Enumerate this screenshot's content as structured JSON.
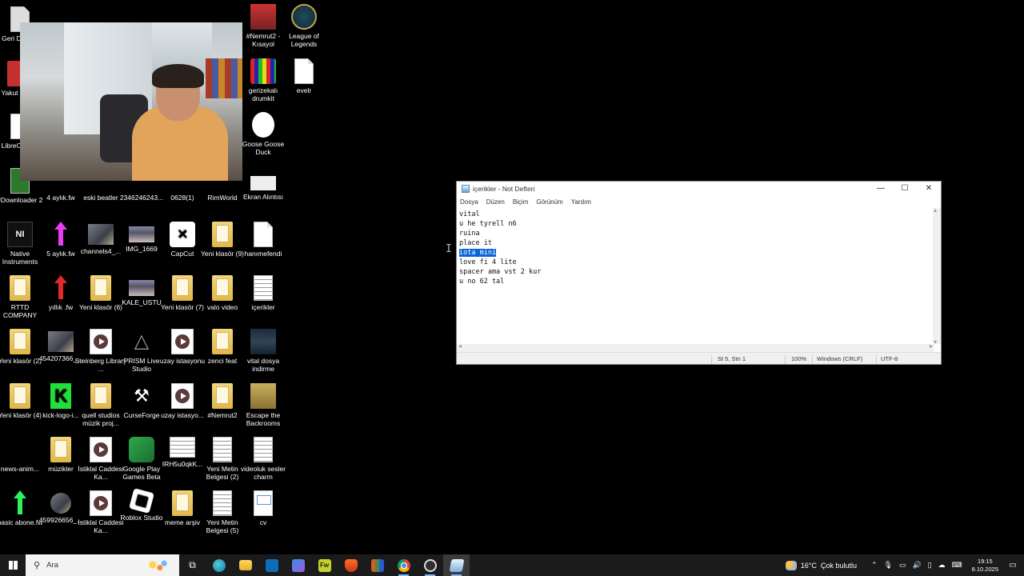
{
  "desktop": {
    "icons": [
      {
        "label": "Geri Dönü...",
        "icon": "recycle-bin-icon"
      },
      {
        "label": "Yakut tung...",
        "icon": "pdf-icon"
      },
      {
        "label": "LibreOf... 25",
        "icon": "doc-icon"
      },
      {
        "label": "JDownloader 2",
        "icon": "jdownloader-icon"
      },
      {
        "label": "Native Instruments",
        "icon": "native-instruments-icon"
      },
      {
        "label": "RTTD COMPANY",
        "icon": "folder-icon"
      },
      {
        "label": "Yeni klasör (2)",
        "icon": "folder-icon"
      },
      {
        "label": "Yeni klasör (4)",
        "icon": "folder-icon"
      },
      {
        "label": "news-anim...",
        "icon": "news-icon"
      },
      {
        "label": "basic abone.fw",
        "icon": "arrow-green-icon"
      },
      {
        "label": "4 aylık.fw",
        "icon": "arrow-cyan-icon"
      },
      {
        "label": "5 aylık.fw",
        "icon": "arrow-purple-icon"
      },
      {
        "label": "yıllık .fw",
        "icon": "arrow-red-icon"
      },
      {
        "label": "454207366_...",
        "icon": "photo-icon"
      },
      {
        "label": "kick-logo-i...",
        "icon": "kick-logo-icon"
      },
      {
        "label": "müzikler",
        "icon": "folder-icon"
      },
      {
        "label": "459926656_...",
        "icon": "photo-icon"
      },
      {
        "label": "eski beatler",
        "icon": "folder-icon"
      },
      {
        "label": "channels4_...",
        "icon": "photo-icon"
      },
      {
        "label": "Yeni klasör (6)",
        "icon": "folder-icon"
      },
      {
        "label": "Steinberg Library ...",
        "icon": "video-icon"
      },
      {
        "label": "quell studios müzik proj...",
        "icon": "folder-icon"
      },
      {
        "label": "İstiklal Caddesi Ka...",
        "icon": "video-icon"
      },
      {
        "label": "İstiklal Caddesi Ka...",
        "icon": "video-icon"
      },
      {
        "label": "2346246243...",
        "icon": "folder-icon"
      },
      {
        "label": "IMG_1669",
        "icon": "photo-icon"
      },
      {
        "label": "KALE_USTU",
        "icon": "photo-icon"
      },
      {
        "label": "PRISM Live Studio",
        "icon": "prism-icon"
      },
      {
        "label": "CurseForge",
        "icon": "curseforge-icon"
      },
      {
        "label": "Google Play Games Beta",
        "icon": "google-play-games-icon"
      },
      {
        "label": "Roblox Studio",
        "icon": "roblox-icon"
      },
      {
        "label": "0628(1)",
        "icon": "folder-icon"
      },
      {
        "label": "CapCut",
        "icon": "capcut-icon"
      },
      {
        "label": "Yeni klasör (7)",
        "icon": "folder-icon"
      },
      {
        "label": "uzay istasyonu",
        "icon": "video-icon"
      },
      {
        "label": "uzay istasyo...",
        "icon": "video-icon"
      },
      {
        "label": "IRH5u0qkK...",
        "icon": "photo-icon"
      },
      {
        "label": "meme arşiv",
        "icon": "folder-icon"
      },
      {
        "label": "RimWorld",
        "icon": "rimworld-icon"
      },
      {
        "label": "Yeni klasör (9)",
        "icon": "folder-icon"
      },
      {
        "label": "valo video",
        "icon": "folder-icon"
      },
      {
        "label": "zenci feat",
        "icon": "folder-icon"
      },
      {
        "label": "#Nemrut2",
        "icon": "folder-icon"
      },
      {
        "label": "Yeni Metin Belgesi (2)",
        "icon": "text-file-icon"
      },
      {
        "label": "Yeni Metin Belgesi (5)",
        "icon": "text-file-icon"
      },
      {
        "label": "#Nemrut2 - Kısayol",
        "icon": "nemrut-icon"
      },
      {
        "label": "gerizekalı drumkit",
        "icon": "drumkit-icon"
      },
      {
        "label": "Goose Goose Duck",
        "icon": "goose-icon"
      },
      {
        "label": "Ekran Alıntısı",
        "icon": "screenshot-icon"
      },
      {
        "label": "hanımefendi",
        "icon": "file-icon"
      },
      {
        "label": "içerikler",
        "icon": "text-file-icon"
      },
      {
        "label": "vital dosya indirme",
        "icon": "dark-image-icon"
      },
      {
        "label": "Escape the Backrooms",
        "icon": "backrooms-icon"
      },
      {
        "label": "videoluk sesler charm",
        "icon": "text-file-icon"
      },
      {
        "label": "cv",
        "icon": "cv-icon"
      },
      {
        "label": "League of Legends",
        "icon": "league-icon"
      },
      {
        "label": "evelr",
        "icon": "file-icon"
      }
    ]
  },
  "notepad": {
    "title": "içerikler - Not Defteri",
    "menu": [
      "Dosya",
      "Düzen",
      "Biçim",
      "Görünüm",
      "Yardım"
    ],
    "lines": [
      "vital",
      "u he tyrell n6",
      "ruina",
      "place it",
      "iota mini",
      "love fi 4 lite",
      "spacer ama vst 2 kur",
      "u no 62 tal"
    ],
    "selected_line": "iota mini",
    "status": {
      "position": "St 5, Stn 1",
      "zoom": "100%",
      "line_ending": "Windows (CRLF)",
      "encoding": "UTF-8"
    },
    "controls": {
      "minimize": "—",
      "maximize": "☐",
      "close": "✕"
    }
  },
  "taskbar": {
    "search_placeholder": "Ara",
    "weather": {
      "temp": "16°C",
      "desc": "Çok bulutlu"
    },
    "time": "19:15",
    "date": "8.10.2025",
    "apps": [
      "task-view",
      "edge",
      "file-explorer",
      "outlook",
      "store",
      "fireworks",
      "brave",
      "app-grid",
      "chrome",
      "obs",
      "notepad"
    ]
  }
}
